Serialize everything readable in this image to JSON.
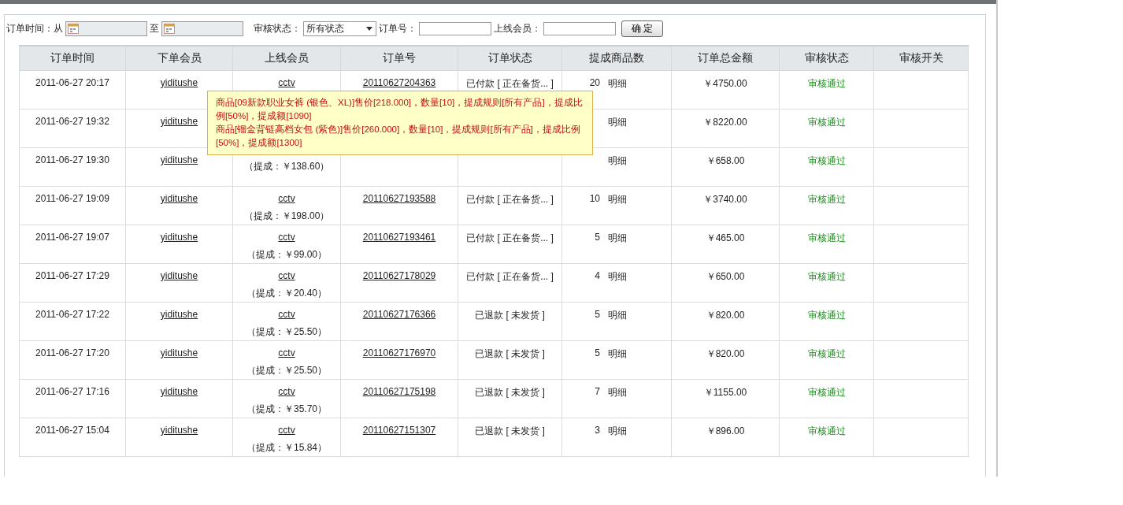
{
  "filters": {
    "time_label": "订单时间：从",
    "to_label": "至",
    "status_label": "审核状态：",
    "status_value": "所有状态",
    "order_label": "订单号：",
    "member_label": "上线会员：",
    "submit": "确 定"
  },
  "table": {
    "columns": [
      "订单时间",
      "下单会员",
      "上线会员",
      "订单号",
      "订单状态",
      "提成商品数",
      "订单总金额",
      "审核状态",
      "审核开关"
    ],
    "rows": [
      {
        "time": "2011-06-27 20:17",
        "member": "yiditushe",
        "online_member": "cctv",
        "order_no": "20110627204363",
        "status": "已付款 [ 正在备货... ]",
        "count": "20",
        "detail": "明细",
        "total": "￥4750.00",
        "audit": "审核通过"
      },
      {
        "time": "2011-06-27 19:32",
        "member": "yiditushe",
        "detail": "明细",
        "total": "￥8220.00",
        "audit": "审核通过"
      },
      {
        "time": "2011-06-27 19:30",
        "member": "yiditushe",
        "commission": "（提成：￥138.60）",
        "detail": "明细",
        "total": "￥658.00",
        "audit": "审核通过"
      },
      {
        "time": "2011-06-27 19:09",
        "member": "yiditushe",
        "online_member": "cctv",
        "commission": "（提成：￥198.00）",
        "order_no": "20110627193588",
        "status": "已付款 [ 正在备货... ]",
        "count": "10",
        "detail": "明细",
        "total": "￥3740.00",
        "audit": "审核通过"
      },
      {
        "time": "2011-06-27 19:07",
        "member": "yiditushe",
        "online_member": "cctv",
        "commission": "（提成：￥99.00）",
        "order_no": "20110627193461",
        "status": "已付款 [ 正在备货... ]",
        "count": "5",
        "detail": "明细",
        "total": "￥465.00",
        "audit": "审核通过"
      },
      {
        "time": "2011-06-27 17:29",
        "member": "yiditushe",
        "online_member": "cctv",
        "commission": "（提成：￥20.40）",
        "order_no": "20110627178029",
        "status": "已付款 [ 正在备货... ]",
        "count": "4",
        "detail": "明细",
        "total": "￥650.00",
        "audit": "审核通过"
      },
      {
        "time": "2011-06-27 17:22",
        "member": "yiditushe",
        "online_member": "cctv",
        "commission": "（提成：￥25.50）",
        "order_no": "20110627176366",
        "status": "已退款 [ 未发货 ]",
        "count": "5",
        "detail": "明细",
        "total": "￥820.00",
        "audit": "审核通过"
      },
      {
        "time": "2011-06-27 17:20",
        "member": "yiditushe",
        "online_member": "cctv",
        "commission": "（提成：￥25.50）",
        "order_no": "20110627176970",
        "status": "已退款 [ 未发货 ]",
        "count": "5",
        "detail": "明细",
        "total": "￥820.00",
        "audit": "审核通过"
      },
      {
        "time": "2011-06-27 17:16",
        "member": "yiditushe",
        "online_member": "cctv",
        "commission": "（提成：￥35.70）",
        "order_no": "20110627175198",
        "status": "已退款 [ 未发货 ]",
        "count": "7",
        "detail": "明细",
        "total": "￥1155.00",
        "audit": "审核通过"
      },
      {
        "time": "2011-06-27 15:04",
        "member": "yiditushe",
        "online_member": "cctv",
        "commission": "（提成：￥15.84）",
        "order_no": "20110627151307",
        "status": "已退款 [ 未发货 ]",
        "count": "3",
        "detail": "明细",
        "total": "￥896.00",
        "audit": "审核通过"
      }
    ]
  },
  "tooltip": {
    "lines": [
      "商品[09新款职业女裤 (银色、XL)]售价[218.000]，数量[10]，提成规则[所有产品]，提成比例[50%]，提成额[1090]",
      "商品[镏金背链高档女包 (紫色)]售价[260.000]，数量[10]，提成规则[所有产品]，提成比例[50%]，提成额[1300]"
    ]
  }
}
